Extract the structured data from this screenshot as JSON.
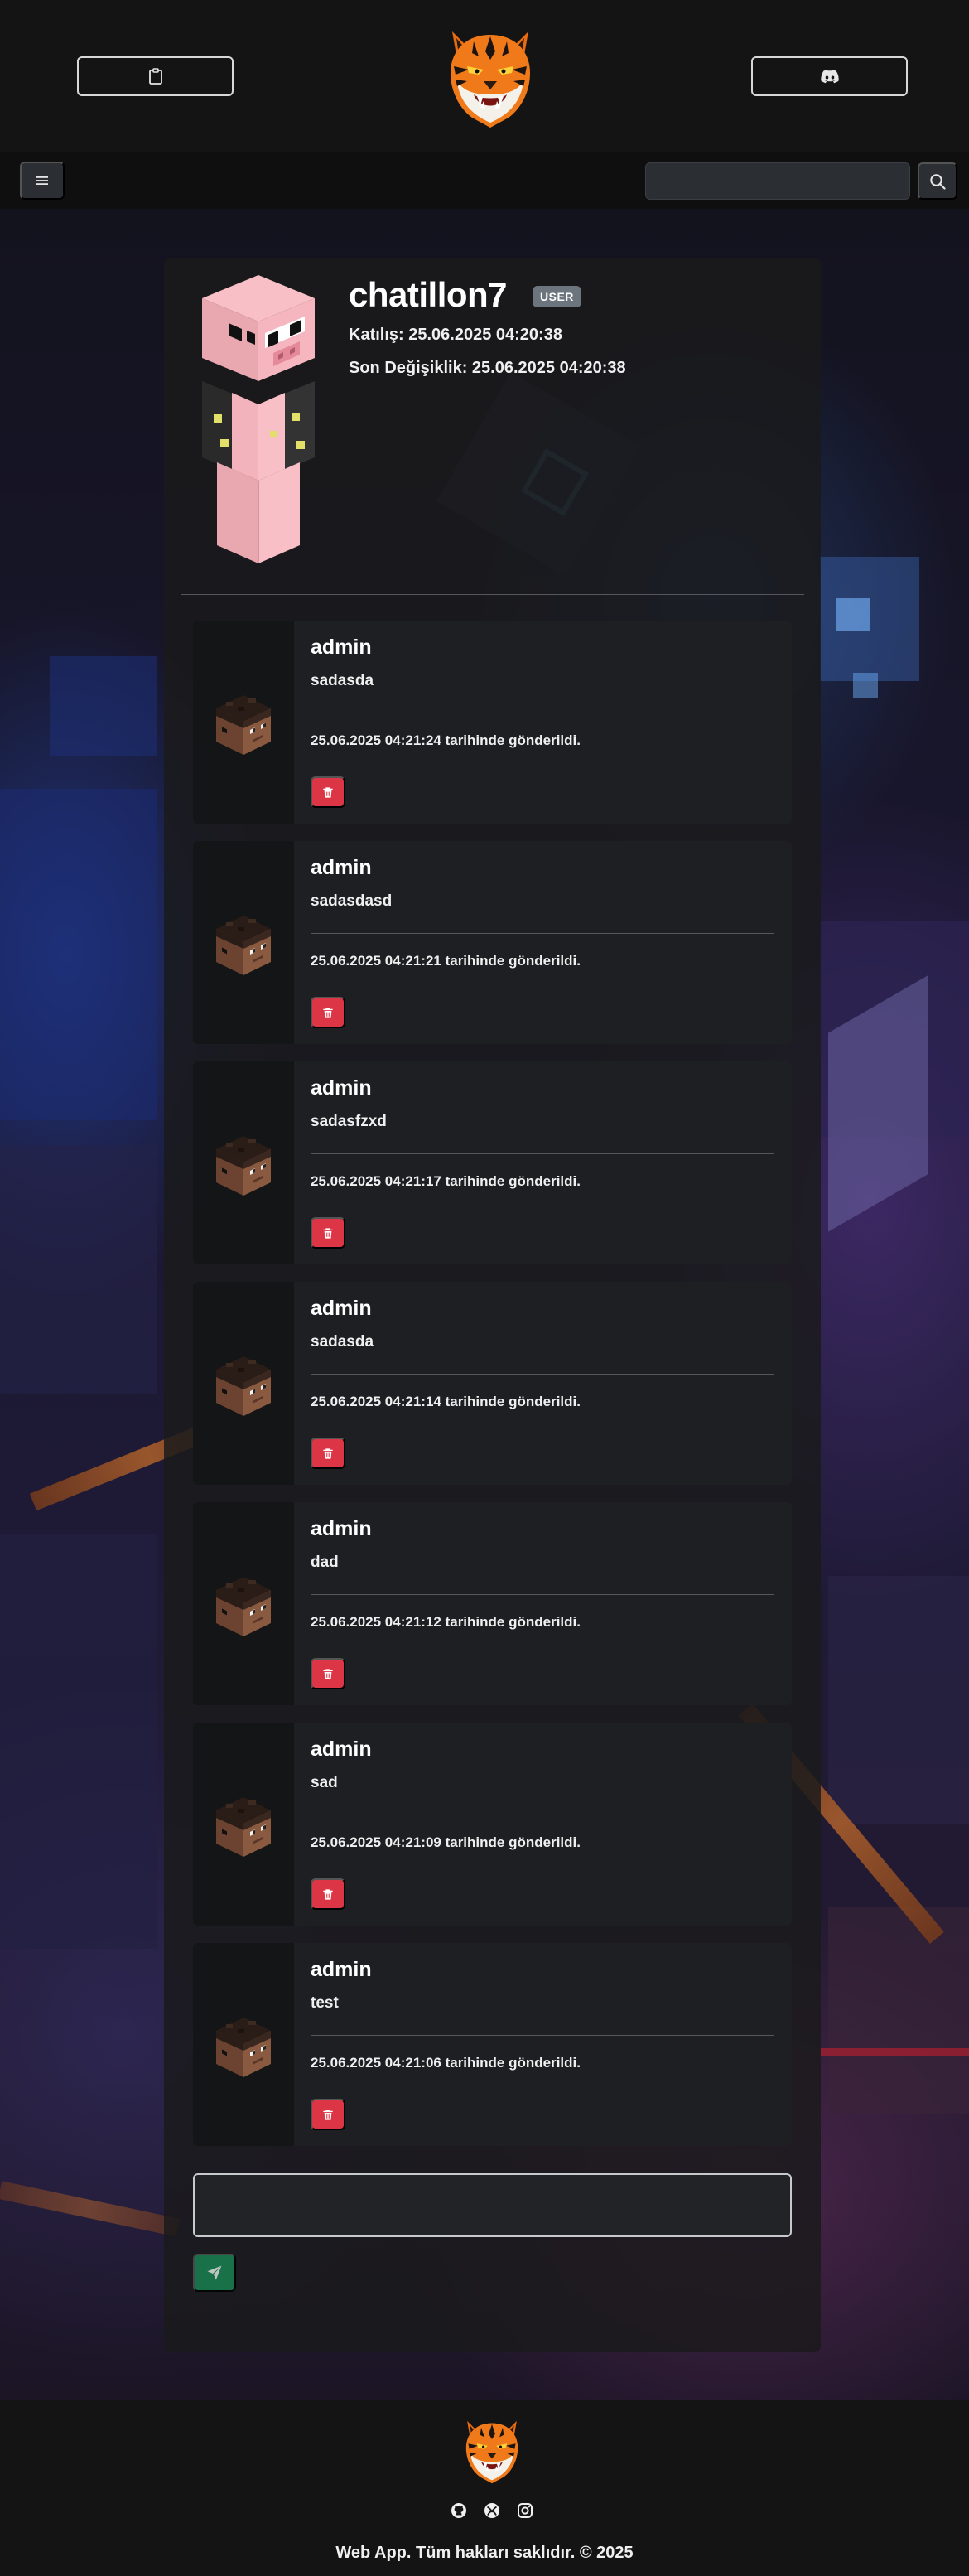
{
  "header": {
    "left_button_icon": "clipboard-icon",
    "right_button_icon": "discord-icon",
    "logo": "tiger-logo"
  },
  "navbar": {
    "menu_icon": "menu-icon",
    "search": {
      "value": "",
      "placeholder": ""
    },
    "search_icon": "search-icon"
  },
  "profile": {
    "username": "chatillon7",
    "role": "USER",
    "joined": "Katılış: 25.06.2025 04:20:38",
    "modified": "Son Değişiklik: 25.06.2025 04:20:38"
  },
  "comments": [
    {
      "author": "admin",
      "text": "sadasda",
      "date": "25.06.2025 04:21:24 tarihinde gönderildi."
    },
    {
      "author": "admin",
      "text": "sadasdasd",
      "date": "25.06.2025 04:21:21 tarihinde gönderildi."
    },
    {
      "author": "admin",
      "text": "sadasfzxd",
      "date": "25.06.2025 04:21:17 tarihinde gönderildi."
    },
    {
      "author": "admin",
      "text": "sadasda",
      "date": "25.06.2025 04:21:14 tarihinde gönderildi."
    },
    {
      "author": "admin",
      "text": "dad",
      "date": "25.06.2025 04:21:12 tarihinde gönderildi."
    },
    {
      "author": "admin",
      "text": "sad",
      "date": "25.06.2025 04:21:09 tarihinde gönderildi."
    },
    {
      "author": "admin",
      "text": "test",
      "date": "25.06.2025 04:21:06 tarihinde gönderildi."
    }
  ],
  "composer": {
    "value": "",
    "placeholder": "",
    "send_icon": "send-icon"
  },
  "footer": {
    "social": [
      "github-icon",
      "xbox-icon",
      "instagram-icon"
    ],
    "copyright": "Web App. Tüm hakları saklıdır. © 2025"
  },
  "colors": {
    "danger": "#dc3545",
    "success": "#198754",
    "badge": "#6c757d",
    "tiger_orange": "#f07a1a"
  }
}
